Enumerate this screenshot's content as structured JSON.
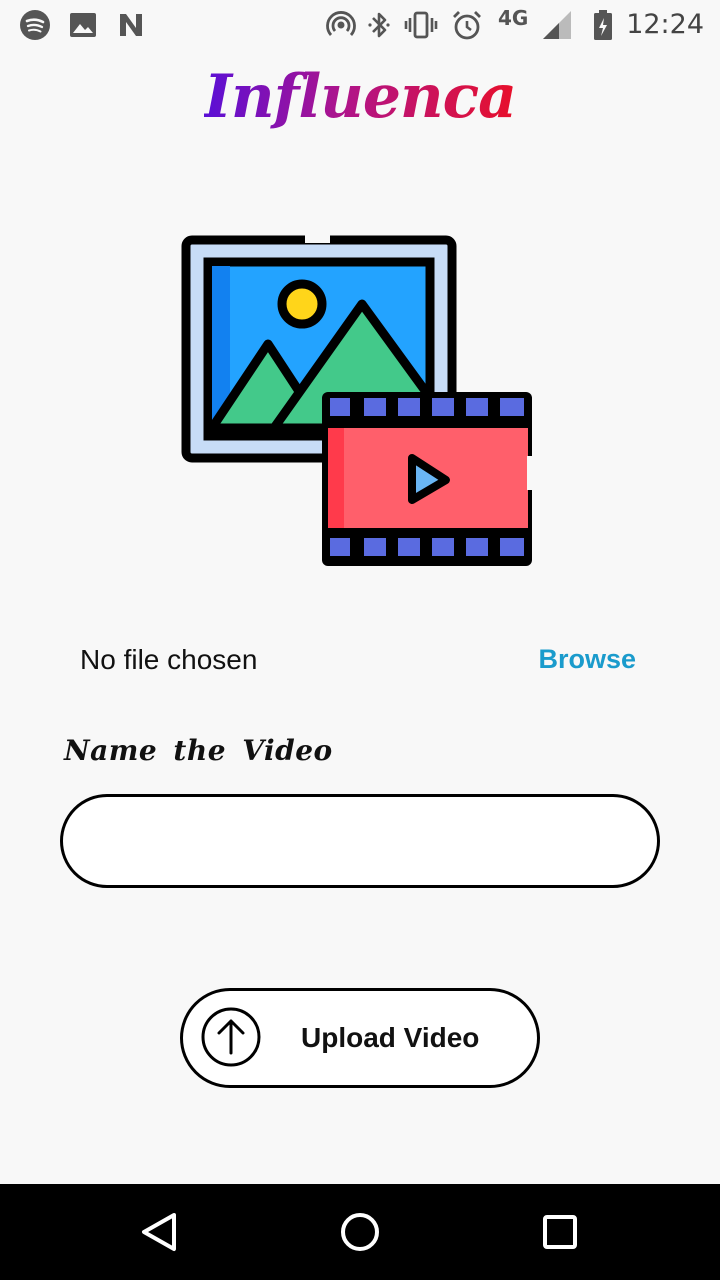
{
  "status_bar": {
    "icons": [
      "spotify-icon",
      "image-icon",
      "n-app-icon",
      "hotspot-icon",
      "bluetooth-icon",
      "vibrate-icon",
      "alarm-icon",
      "signal-icon",
      "battery-icon"
    ],
    "network": "4G",
    "time": "12:24"
  },
  "app": {
    "title": "Influenca",
    "brand_colors": [
      "#5a0fd6",
      "#b0148a",
      "#e8102a"
    ]
  },
  "illustration": {
    "icon": "photo-video-icon"
  },
  "file_picker": {
    "status": "No file chosen",
    "browse_label": "Browse",
    "accent": "#1a9bcc"
  },
  "name_field": {
    "label": "Name the Video",
    "value": "",
    "placeholder": ""
  },
  "upload": {
    "label": "Upload Video",
    "icon": "arrow-up-circle-icon"
  },
  "nav_bar": {
    "buttons": [
      "back-icon",
      "home-icon",
      "recents-icon"
    ]
  }
}
